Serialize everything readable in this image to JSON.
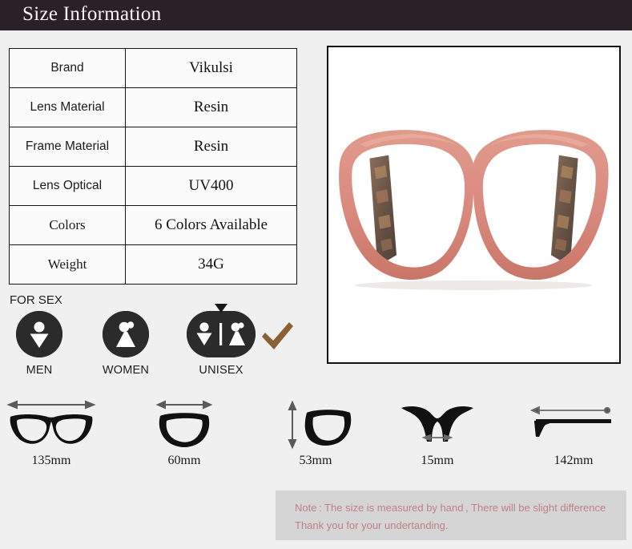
{
  "header": {
    "title": "Size Information"
  },
  "spec_table": {
    "rows": [
      {
        "label": "Brand",
        "value": "Vikulsi"
      },
      {
        "label": "Lens Material",
        "value": "Resin"
      },
      {
        "label": "Frame Material",
        "value": "Resin"
      },
      {
        "label": "Lens Optical",
        "value": "UV400"
      },
      {
        "label": "Colors",
        "value": "6 Colors Available"
      },
      {
        "label": "Weight",
        "value": "34G"
      }
    ]
  },
  "product_photo": {
    "alt": "pink cat-eye eyeglasses frame",
    "frame_color": "#d9897d",
    "frame_shadow_color": "#c4705f",
    "temple_pattern_color": "#6b5648",
    "background": "#ffffff",
    "border_color": "#121212"
  },
  "for_sex": {
    "section_label": "FOR SEX",
    "options": [
      {
        "caption": "MEN",
        "icon": "man-figure-icon",
        "selected": false
      },
      {
        "caption": "WOMEN",
        "icon": "woman-figure-icon",
        "selected": false
      },
      {
        "caption": "UNISEX",
        "icon": "man-woman-figures-icon",
        "selected": true
      }
    ],
    "selected_caption": "UNISEX",
    "badge_color": "#2b2b2b",
    "check_color": "#8a6134",
    "cursor_icon": "triangle-cursor-icon",
    "check_icon": "checkmark-icon"
  },
  "measurements": [
    {
      "label": "135mm",
      "icon": "frame-total-width-icon",
      "dimension": "total frame width"
    },
    {
      "label": "60mm",
      "icon": "lens-width-icon",
      "dimension": "lens width"
    },
    {
      "label": "53mm",
      "icon": "lens-height-icon",
      "dimension": "lens height"
    },
    {
      "label": "15mm",
      "icon": "bridge-width-icon",
      "dimension": "bridge width"
    },
    {
      "label": "142mm",
      "icon": "temple-length-icon",
      "dimension": "temple length"
    }
  ],
  "note": {
    "line1": "Note : The size is measured by hand , There will be slight difference",
    "line2": "Thank you for your undertanding.",
    "text_color": "#bf8186",
    "background": "#d5d5d5"
  },
  "theme": {
    "page_background": "#f0f0f0",
    "header_background": "#2b2028",
    "header_text": "#f5f2f4",
    "table_border": "#141414"
  }
}
